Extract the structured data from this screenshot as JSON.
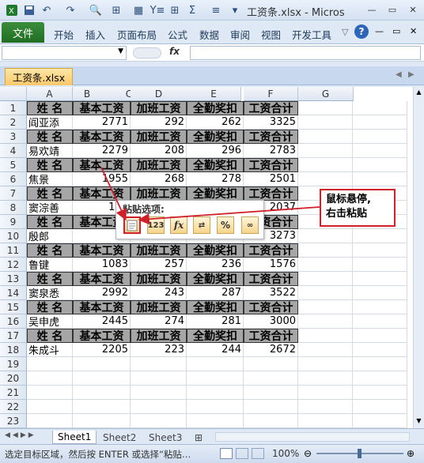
{
  "window": {
    "title": "工资条.xlsx - Micros"
  },
  "ribbon": {
    "file": "文件",
    "tabs": [
      "开始",
      "插入",
      "页面布局",
      "公式",
      "数据",
      "审阅",
      "视图",
      "开发工具"
    ]
  },
  "formula": {
    "fx": "fx"
  },
  "doc": {
    "tab": "工资条.xlsx"
  },
  "columns": [
    "A",
    "B",
    "C",
    "D",
    "E",
    "F",
    "G"
  ],
  "rows": [
    "1",
    "2",
    "3",
    "4",
    "5",
    "6",
    "7",
    "8",
    "9",
    "10",
    "11",
    "12",
    "13",
    "14",
    "15",
    "16",
    "17",
    "18",
    "19",
    "20",
    "21",
    "22",
    "23"
  ],
  "header": [
    "姓 名",
    "基本工资",
    "加班工资",
    "全勤奖扣",
    "工资合计"
  ],
  "records": [
    {
      "row": 2,
      "name": "阎亚添",
      "base": "2771",
      "ot": "292",
      "att": "262",
      "total": "3325"
    },
    {
      "row": 4,
      "name": "易欢靖",
      "base": "2279",
      "ot": "208",
      "att": "296",
      "total": "2783"
    },
    {
      "row": 6,
      "name": "焦景",
      "base": "1955",
      "ot": "268",
      "att": "278",
      "total": "2501"
    },
    {
      "row": 8,
      "name": "窦淙善",
      "base": "150",
      "ot": "",
      "att": "",
      "total": "2037"
    },
    {
      "row": 10,
      "name": "殷郎",
      "base": "27",
      "ot": "",
      "att": "",
      "total": "3273"
    },
    {
      "row": 12,
      "name": "鲁键",
      "base": "1083",
      "ot": "257",
      "att": "236",
      "total": "1576"
    },
    {
      "row": 14,
      "name": "窦泉悉",
      "base": "2992",
      "ot": "243",
      "att": "287",
      "total": "3522"
    },
    {
      "row": 16,
      "name": "吴申虎",
      "base": "2445",
      "ot": "274",
      "att": "281",
      "total": "3000"
    },
    {
      "row": 18,
      "name": "朱成斗",
      "base": "2205",
      "ot": "223",
      "att": "244",
      "total": "2672"
    }
  ],
  "paste_menu": {
    "label": "粘贴选项:",
    "icons": [
      "paste-icon",
      "values-123-icon",
      "formula-fx-icon",
      "transpose-icon",
      "formatting-icon",
      "link-icon"
    ]
  },
  "callout": {
    "text_line1": "鼠标悬停,",
    "text_line2": "右击粘贴"
  },
  "sheets": [
    "Sheet1",
    "Sheet2",
    "Sheet3"
  ],
  "status": {
    "message": "选定目标区域，然后按 ENTER 或选择“粘贴…",
    "zoom": "100%"
  }
}
